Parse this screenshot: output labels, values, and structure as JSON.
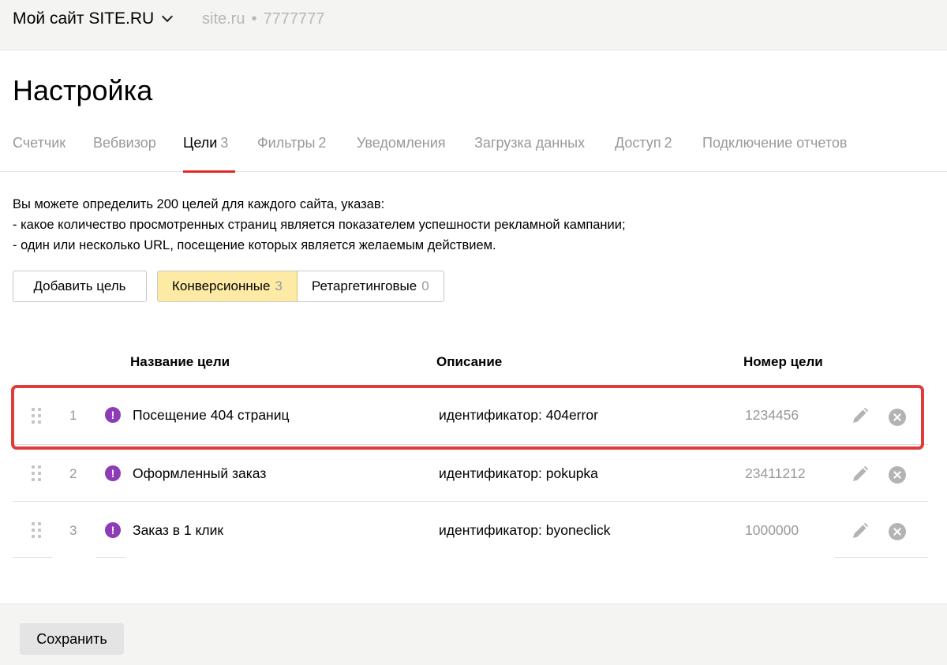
{
  "header": {
    "site_name": "Мой сайт SITE.RU",
    "site_domain": "site.ru",
    "separator": "•",
    "counter_id": "7777777"
  },
  "page": {
    "title": "Настройка"
  },
  "tabs": [
    {
      "label": "Счетчик",
      "count": ""
    },
    {
      "label": "Вебвизор",
      "count": ""
    },
    {
      "label": "Цели",
      "count": "3",
      "active": true
    },
    {
      "label": "Фильтры",
      "count": "2"
    },
    {
      "label": "Уведомления",
      "count": ""
    },
    {
      "label": "Загрузка данных",
      "count": ""
    },
    {
      "label": "Доступ",
      "count": "2"
    },
    {
      "label": "Подключение отчетов",
      "count": ""
    }
  ],
  "intro": {
    "line1": "Вы можете определить 200 целей для каждого сайта, указав:",
    "line2": "-  какое количество просмотренных страниц является показателем успешности рекламной кампании;",
    "line3": "-  один или несколько URL, посещение которых является желаемым действием."
  },
  "actions": {
    "add_goal": "Добавить цель",
    "filter_conversion": {
      "label": "Конверсионные",
      "count": "3"
    },
    "filter_retargeting": {
      "label": "Ретаргетинговые",
      "count": "0"
    }
  },
  "table": {
    "headers": {
      "name": "Название цели",
      "description": "Описание",
      "id": "Номер цели"
    },
    "rows": [
      {
        "num": "1",
        "warn": "!",
        "name": "Посещение 404 страниц",
        "description": "идентификатор: 404error",
        "id": "1234456"
      },
      {
        "num": "2",
        "warn": "!",
        "name": "Оформленный заказ",
        "description": "идентификатор: pokupka",
        "id": "23411212"
      },
      {
        "num": "3",
        "warn": "!",
        "name": "Заказ в 1 клик",
        "description": "идентификатор: byoneclick",
        "id": "1000000"
      }
    ]
  },
  "footer": {
    "save": "Сохранить"
  },
  "colors": {
    "accent_red": "#e32a2a",
    "highlight_red": "#e03c3c",
    "warning_purple": "#8e3bb8",
    "active_segment": "#fdeba5"
  }
}
